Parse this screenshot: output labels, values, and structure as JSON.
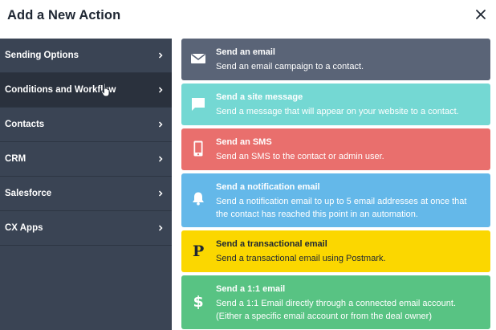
{
  "dialog": {
    "title": "Add a New Action"
  },
  "sidebar": {
    "items": [
      {
        "label": "Sending Options"
      },
      {
        "label": "Conditions and Workflow"
      },
      {
        "label": "Contacts"
      },
      {
        "label": "CRM"
      },
      {
        "label": "Salesforce"
      },
      {
        "label": "CX Apps"
      }
    ]
  },
  "actions": [
    {
      "title": "Send an email",
      "description": "Send an email campaign to a contact.",
      "icon": "envelope-icon",
      "color": "#5a6477"
    },
    {
      "title": "Send a site message",
      "description": "Send a message that will appear on your website to a contact.",
      "icon": "chat-bubble-icon",
      "color": "#74d8d3"
    },
    {
      "title": "Send an SMS",
      "description": "Send an SMS to the contact or admin user.",
      "icon": "phone-icon",
      "color": "#e96f6d"
    },
    {
      "title": "Send a notification email",
      "description": "Send a notification email to up to 5 email addresses at once that the contact has reached this point in an automation.",
      "icon": "bell-icon",
      "color": "#64b8e9"
    },
    {
      "title": "Send a transactional email",
      "description": "Send a transactional email using Postmark.",
      "icon": "postmark-p-icon",
      "color": "#fbd700"
    },
    {
      "title": "Send a 1:1 email",
      "description": "Send a 1:1 Email directly through a connected email account. (Either a specific email account or from the deal owner)",
      "icon": "dollar-icon",
      "color": "#58c383"
    }
  ],
  "colors": {
    "sidebar_bg": "#3a4454",
    "sidebar_active": "#2a313d",
    "title_text": "#1f2733"
  }
}
